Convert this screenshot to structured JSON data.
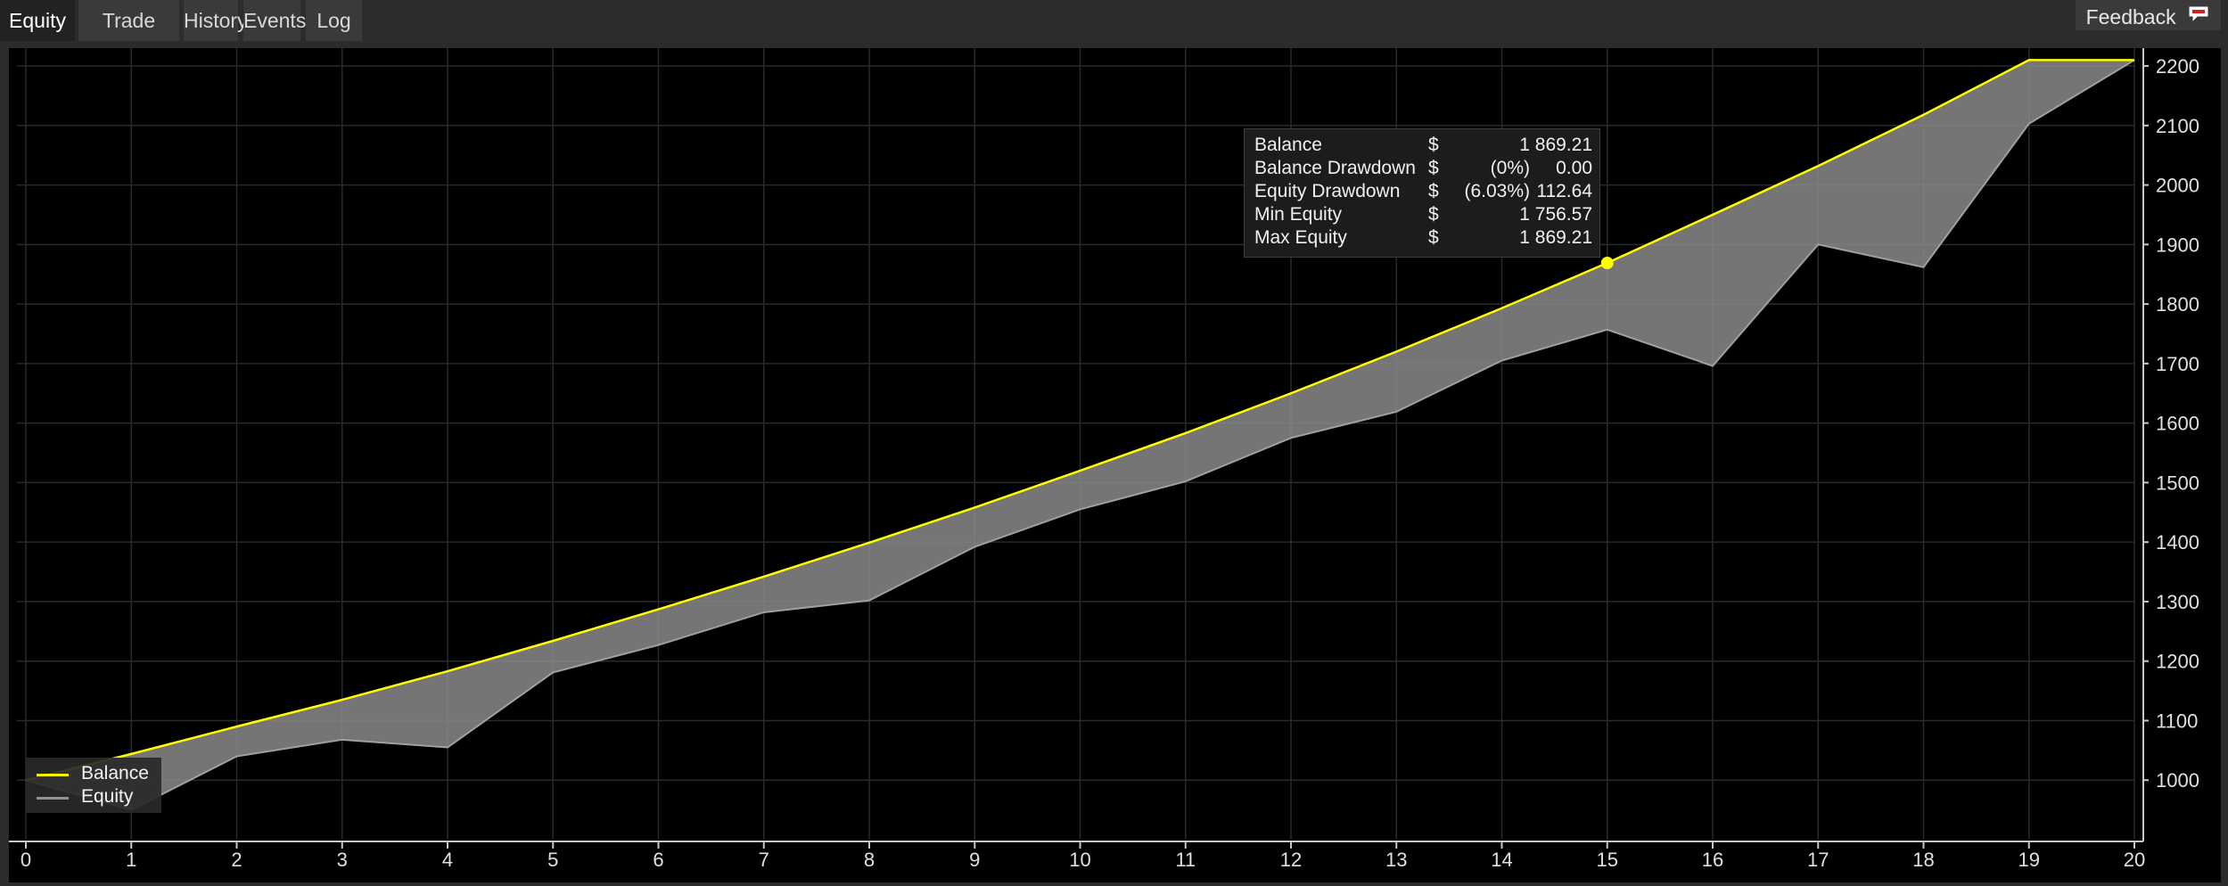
{
  "tabs": [
    {
      "label": "Equity Chart",
      "active": true
    },
    {
      "label": "Trade Statistics",
      "active": false
    },
    {
      "label": "History",
      "active": false
    },
    {
      "label": "Events",
      "active": false
    },
    {
      "label": "Log",
      "active": false
    }
  ],
  "feedback": {
    "label": "Feedback",
    "icon": "speech-bubble-icon"
  },
  "legend": {
    "balance_label": "Balance",
    "equity_label": "Equity"
  },
  "tooltip": {
    "rows": [
      {
        "label": "Balance",
        "currency": "$",
        "pct": "",
        "value": "1 869.21"
      },
      {
        "label": "Balance Drawdown",
        "currency": "$",
        "pct": "(0%)",
        "value": "0.00"
      },
      {
        "label": "Equity Drawdown",
        "currency": "$",
        "pct": "(6.03%)",
        "value": "112.64"
      },
      {
        "label": "Min Equity",
        "currency": "$",
        "pct": "",
        "value": "1 756.57"
      },
      {
        "label": "Max Equity",
        "currency": "$",
        "pct": "",
        "value": "1 869.21"
      }
    ],
    "highlight_x": 15
  },
  "colors": {
    "balance": "#ffff00",
    "equity_line": "#a0a0a0",
    "equity_fill": "#8a8a8a",
    "grid": "#2a2a2a",
    "axis": "#c8c8c8"
  },
  "chart_data": {
    "type": "area",
    "x": [
      0,
      1,
      2,
      3,
      4,
      5,
      6,
      7,
      8,
      9,
      10,
      11,
      12,
      13,
      14,
      15,
      16,
      17,
      18,
      19,
      20
    ],
    "xlim": [
      0,
      20
    ],
    "ylim": [
      900,
      2230
    ],
    "yticks": [
      1000,
      1100,
      1200,
      1300,
      1400,
      1500,
      1600,
      1700,
      1800,
      1900,
      2000,
      2100,
      2200
    ],
    "grid": true,
    "legend_position": "bottom-left",
    "series": [
      {
        "name": "Balance",
        "values": [
          1000,
          1044,
          1090,
          1135,
          1183,
          1234,
          1287,
          1342,
          1399,
          1458,
          1520,
          1583,
          1650,
          1720,
          1793,
          1869,
          1950,
          2032,
          2118,
          2210,
          2210
        ]
      },
      {
        "name": "Equity",
        "values": [
          1000,
          950,
          1040,
          1068,
          1055,
          1181,
          1227,
          1282,
          1302,
          1392,
          1455,
          1502,
          1575,
          1619,
          1705,
          1757,
          1696,
          1900,
          1862,
          2103,
          2210
        ]
      }
    ]
  }
}
